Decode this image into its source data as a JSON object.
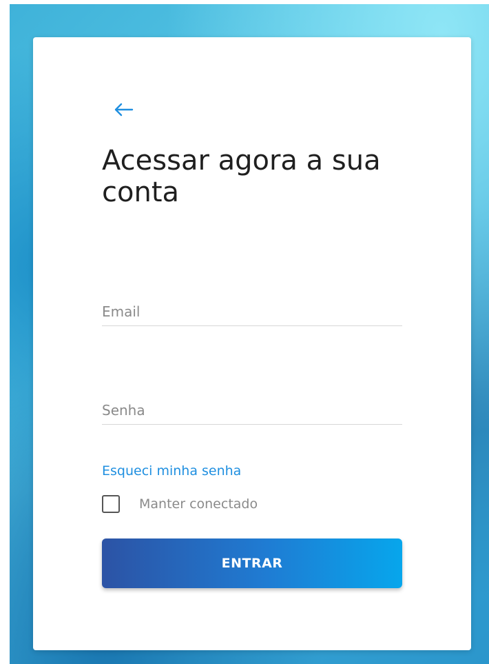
{
  "login": {
    "back_icon": "arrow-left-icon",
    "title": "Acessar agora a sua conta",
    "email_placeholder": "Email",
    "password_placeholder": "Senha",
    "forgot_link": "Esqueci minha senha",
    "remember_label": "Manter conectado",
    "remember_checked": false,
    "submit_label": "ENTRAR"
  },
  "colors": {
    "accent": "#1f8fe0",
    "button_gradient_start": "#2c53a5",
    "button_gradient_end": "#07a6ec"
  }
}
